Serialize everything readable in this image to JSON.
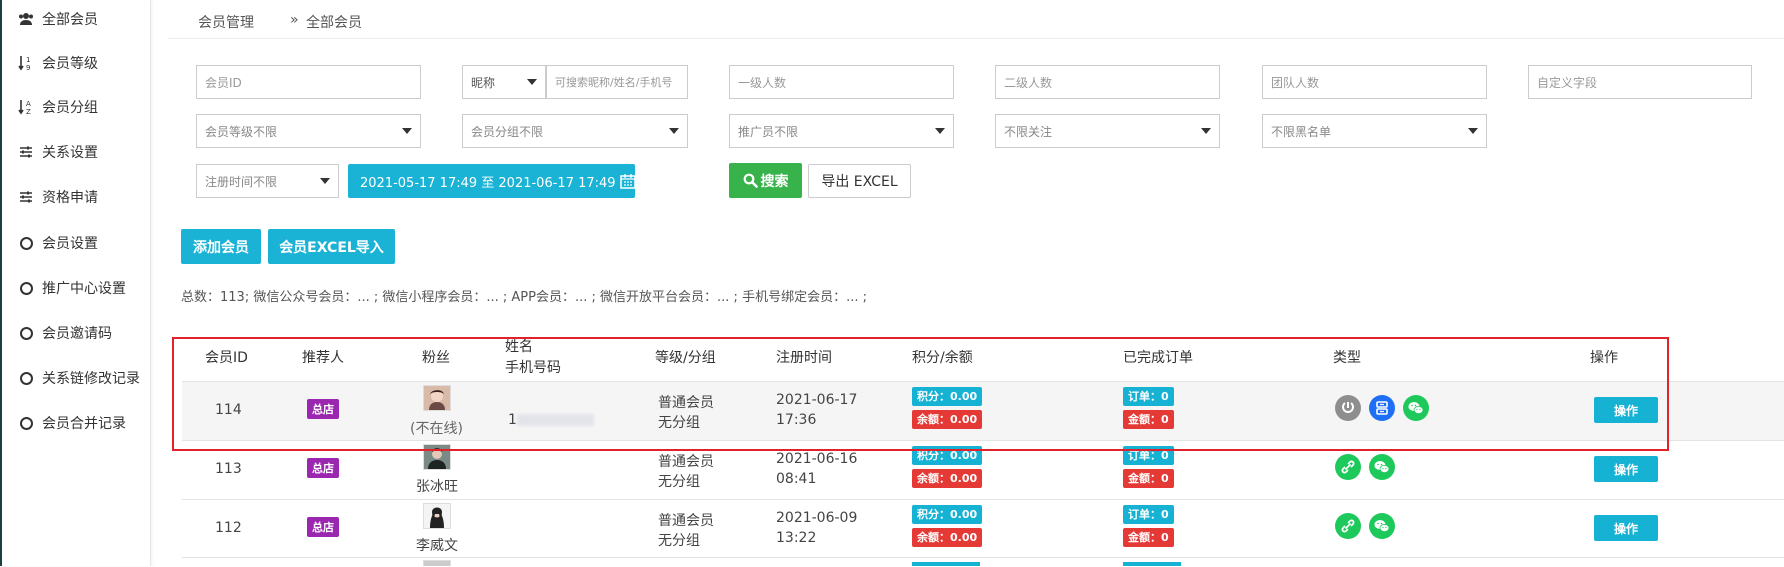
{
  "sidebar": {
    "items": [
      {
        "label": "全部会员",
        "icon": "users-icon"
      },
      {
        "label": "会员等级",
        "icon": "sort-numeric-icon"
      },
      {
        "label": "会员分组",
        "icon": "sort-alpha-icon"
      },
      {
        "label": "关系设置",
        "icon": "sliders-icon"
      },
      {
        "label": "资格申请",
        "icon": "sliders-icon"
      },
      {
        "label": "会员设置",
        "icon": "circle-icon"
      },
      {
        "label": "推广中心设置",
        "icon": "circle-icon"
      },
      {
        "label": "会员邀请码",
        "icon": "circle-icon"
      },
      {
        "label": "关系链修改记录",
        "icon": "circle-icon"
      },
      {
        "label": "会员合并记录",
        "icon": "circle-icon"
      }
    ]
  },
  "breadcrumb": {
    "parent": "会员管理",
    "separator": "»",
    "current": "全部会员"
  },
  "filters": {
    "member_id_placeholder": "会员ID",
    "nickname_select": "昵称",
    "nickname_placeholder": "可搜索昵称/姓名/手机号",
    "level1_placeholder": "一级人数",
    "level2_placeholder": "二级人数",
    "team_placeholder": "团队人数",
    "custom_placeholder": "自定义字段",
    "level_select": "会员等级不限",
    "group_select": "会员分组不限",
    "promoter_select": "推广员不限",
    "follow_select": "不限关注",
    "blacklist_select": "不限黑名单",
    "regtime_select": "注册时间不限",
    "date_range": "2021-05-17 17:49 至 2021-06-17 17:49",
    "search_label": "搜索",
    "export_label": "导出 EXCEL"
  },
  "actions": {
    "add_label": "添加会员",
    "import_label": "会员EXCEL导入"
  },
  "summary": "总数：113; 微信公众号会员：... ;   微信小程序会员：... ;   APP会员：... ;   微信开放平台会员：... ;   手机号绑定会员：... ;",
  "table": {
    "headers": {
      "id": "会员ID",
      "referrer": "推荐人",
      "fans": "粉丝",
      "name": "姓名",
      "phone": "手机号码",
      "level_group": "等级/分组",
      "reg_time": "注册时间",
      "points_balance": "积分/余额",
      "orders": "已完成订单",
      "type": "类型",
      "ops": "操作"
    },
    "rows": [
      {
        "id": "114",
        "referrer": "总店",
        "fan_name": "(不在线)",
        "phone": "1",
        "level": "普通会员",
        "group": "无分组",
        "date": "2021-06-17",
        "time": "17:36",
        "points": "积分：0.00",
        "balance": "余额：0.00",
        "orders": "订单：0",
        "amount": "金额：0",
        "op": "操作",
        "types": [
          "link-icon",
          "mini-program-icon",
          "wechat-icon"
        ]
      },
      {
        "id": "113",
        "referrer": "总店",
        "fan_name": "张冰旺",
        "phone": "",
        "level": "普通会员",
        "group": "无分组",
        "date": "2021-06-16",
        "time": "08:41",
        "points": "积分：0.00",
        "balance": "余额：0.00",
        "orders": "订单：0",
        "amount": "金额：0",
        "op": "操作",
        "types": [
          "link-icon",
          "wechat-icon"
        ]
      },
      {
        "id": "112",
        "referrer": "总店",
        "fan_name": "李威文",
        "phone": "",
        "level": "普通会员",
        "group": "无分组",
        "date": "2021-06-09",
        "time": "13:22",
        "points": "积分：0.00",
        "balance": "余额：0.00",
        "orders": "订单：0",
        "amount": "金额：0",
        "op": "操作",
        "types": [
          "link-icon",
          "wechat-icon"
        ]
      }
    ]
  },
  "colors": {
    "cyan": "#16b2d4",
    "red": "#e53935",
    "purple": "#9b27b0",
    "green": "#38b24a",
    "wechat": "#1ec95c",
    "highlight": "#e2222a"
  }
}
